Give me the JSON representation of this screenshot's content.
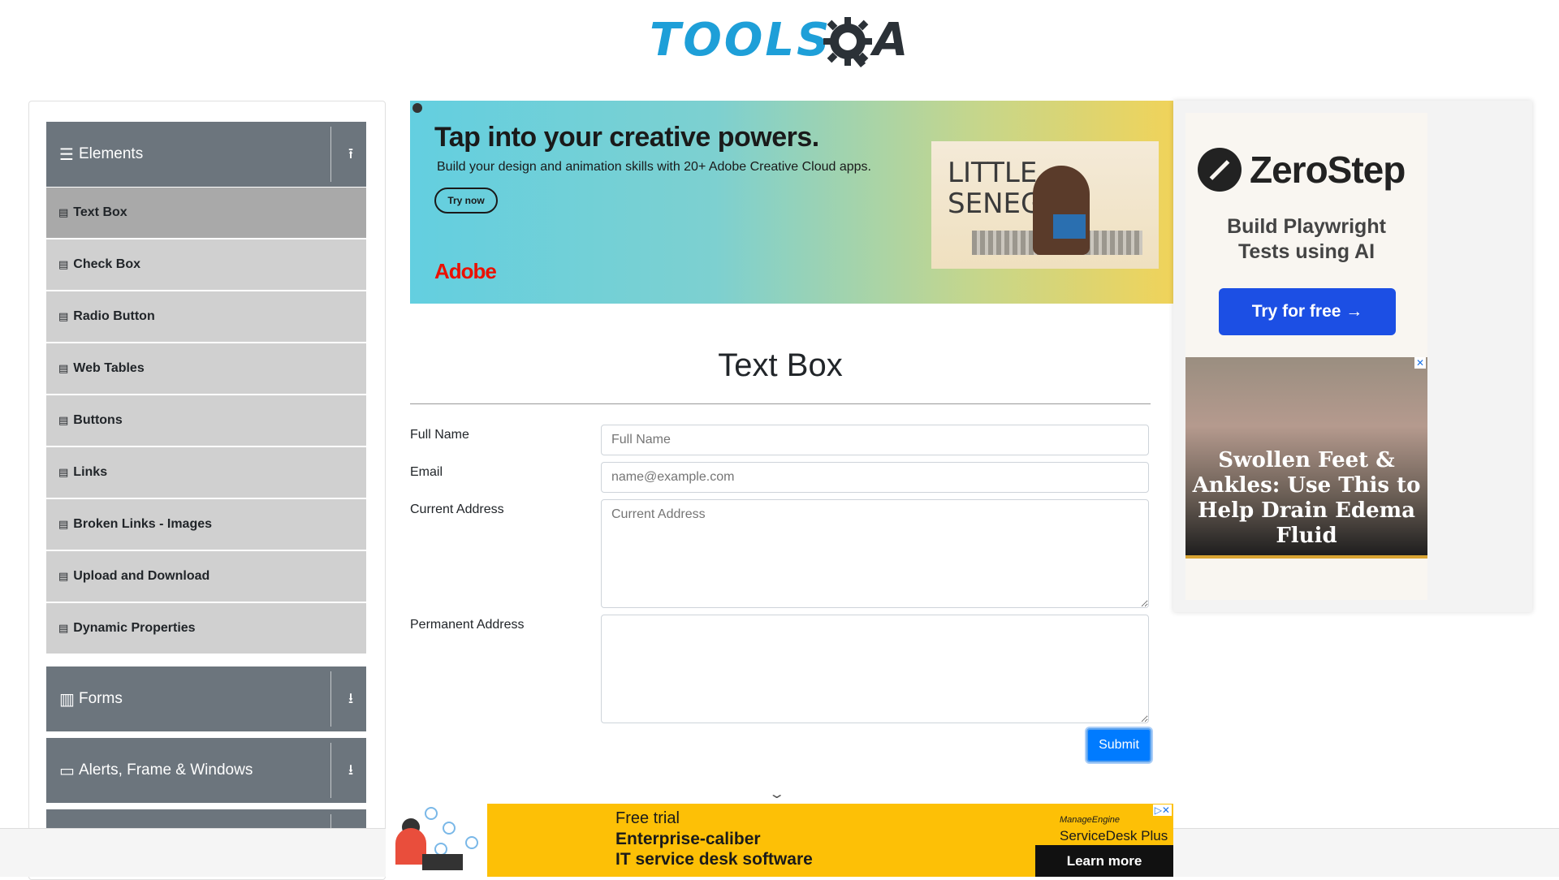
{
  "logo": {
    "left": "TOOLS",
    "right": "QA"
  },
  "sidebar": {
    "groups": [
      {
        "label": "Elements",
        "icon": "menu-icon",
        "arrow": "⭱"
      },
      {
        "label": "Forms",
        "icon": "form-icon",
        "arrow": "⭳"
      },
      {
        "label": "Alerts, Frame & Windows",
        "icon": "window-icon",
        "arrow": "⭳"
      }
    ],
    "items": [
      {
        "label": "Text Box"
      },
      {
        "label": "Check Box"
      },
      {
        "label": "Radio Button"
      },
      {
        "label": "Web Tables"
      },
      {
        "label": "Buttons"
      },
      {
        "label": "Links"
      },
      {
        "label": "Broken Links - Images"
      },
      {
        "label": "Upload and Download"
      },
      {
        "label": "Dynamic Properties"
      }
    ]
  },
  "ad_top": {
    "title": "Tap into your creative powers.",
    "subtitle": "Build your design and animation skills with 20+ Adobe Creative Cloud apps.",
    "button": "Try now",
    "brand": "Adobe",
    "poster_text": "LITTLE SENEGAL"
  },
  "main": {
    "title": "Text Box",
    "fields": {
      "full_name": {
        "label": "Full Name",
        "placeholder": "Full Name"
      },
      "email": {
        "label": "Email",
        "placeholder": "name@example.com"
      },
      "current_address": {
        "label": "Current Address",
        "placeholder": "Current Address"
      },
      "permanent_address": {
        "label": "Permanent Address",
        "placeholder": ""
      }
    },
    "submit": "Submit"
  },
  "ad_right": {
    "brand": "ZeroStep",
    "tagline": "Build Playwright Tests using AI",
    "button": "Try for free →",
    "caption": "Swollen Feet & Ankles: Use This to Help Drain Edema Fluid"
  },
  "ad_bottom": {
    "line1": "Free trial",
    "line2": "Enterprise-caliber",
    "line3": "IT service desk software",
    "brand_small": "ManageEngine",
    "brand": "ServiceDesk Plus",
    "button": "Learn more"
  },
  "colors": {
    "sidebar_group": "#6c757d",
    "menu_item": "#d0d0d0",
    "menu_item_active": "#a9a9a9",
    "submit": "#007bff",
    "logo_tools": "#1e9fd8"
  }
}
